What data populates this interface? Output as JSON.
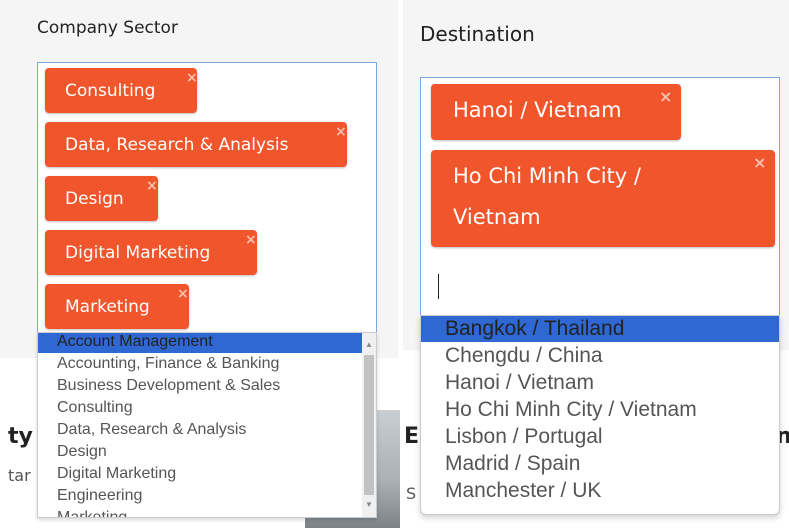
{
  "company_sector": {
    "title": "Company Sector",
    "tags": [
      {
        "label": "Consulting"
      },
      {
        "label": "Data, Research & Analysis"
      },
      {
        "label": "Design"
      },
      {
        "label": "Digital Marketing"
      },
      {
        "label": "Marketing"
      }
    ],
    "remove_glyph": "×",
    "options": [
      "Account Management",
      "Accounting, Finance & Banking",
      "Business Development & Sales",
      "Consulting",
      "Data, Research & Analysis",
      "Design",
      "Digital Marketing",
      "Engineering",
      "Marketing"
    ],
    "highlighted_option": "Account Management"
  },
  "destination": {
    "title": "Destination",
    "tags": [
      {
        "label": "Hanoi / Vietnam"
      },
      {
        "label_line1": "Ho Chi Minh City /",
        "label_line2": "Vietnam"
      }
    ],
    "remove_glyph": "×",
    "options": [
      "Bangkok / Thailand",
      "Chengdu / China",
      "Hanoi / Vietnam",
      "Ho Chi Minh City / Vietnam",
      "Lisbon / Portugal",
      "Madrid / Spain",
      "Manchester / UK"
    ],
    "highlighted_option": "Bangkok / Thailand"
  },
  "background": {
    "left_fragment_1": "ty",
    "left_fragment_2": "tar",
    "right_fragment_1": "E",
    "right_fragment_2": "S",
    "right_fragment_3": "n"
  },
  "colors": {
    "tag": "#f0552b",
    "highlight": "#2f67d3",
    "focus_border": "#7aa7e0"
  }
}
